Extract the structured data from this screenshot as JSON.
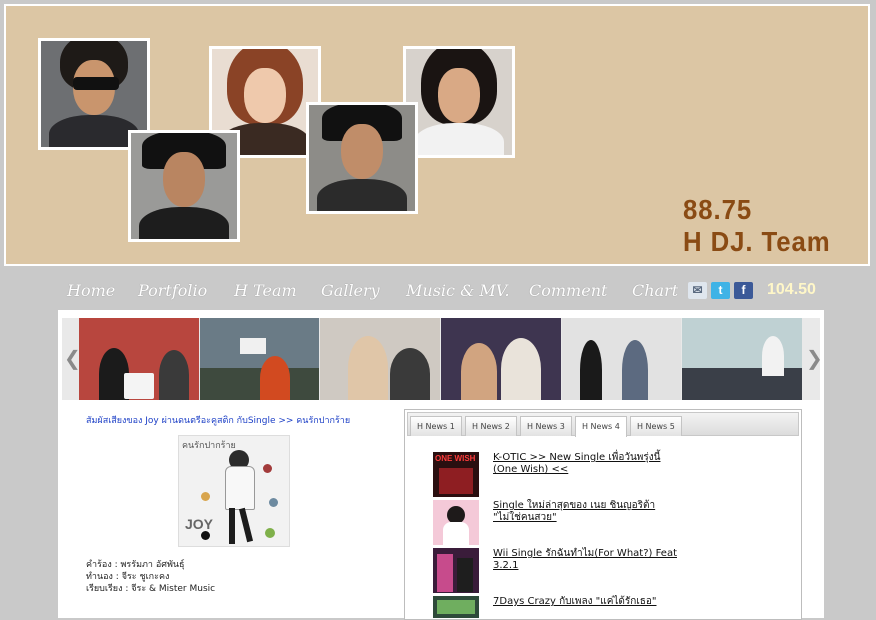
{
  "header": {
    "station_line1": "88.75",
    "station_line2": "H DJ. Team"
  },
  "nav": {
    "items": [
      "Home",
      "Portfolio",
      "H Team",
      "Gallery",
      "Music & MV.",
      "Comment",
      "Chart"
    ],
    "frequency": "104.50",
    "icons": [
      "mail-icon",
      "twitter-icon",
      "facebook-icon"
    ]
  },
  "story": {
    "title": "สัมผัสเสียงของ Joy ผ่านดนตรีอะคูสติก กับSingle >> คนรักปากร้าย",
    "cover_title": "คนรักปากร้าย",
    "cover_artist": "JOY",
    "credits": [
      "คำร้อง : พรรัมภา อัศพันธุ์",
      "ทำนอง : จีระ ชูเกะคง",
      "เรียบเรียง : จีระ & Mister Music"
    ]
  },
  "tabs": [
    "H News 1",
    "H News 2",
    "H News 3",
    "H News 4",
    "H News 5"
  ],
  "active_tab": "H News 4",
  "news": [
    {
      "title": "K-OTIC >> New Single เพื่อวันพรุ่งนี้ (One Wish) <<",
      "thumb_label": "ONE WISH"
    },
    {
      "title": "Single ใหม่ล่าสุดของ เนย ชินญอริต้า \"ไม่ใช่คนสวย\"",
      "thumb_label": ""
    },
    {
      "title": "Wii Single รักฉันทำไม(For What?) Feat 3.2.1",
      "thumb_label": ""
    },
    {
      "title": "7Days Crazy กับเพลง \"แค่ได้รักเธอ\"",
      "thumb_label": ""
    }
  ],
  "colors": {
    "banner": "#dcc6a4",
    "station_text": "#8a4b14",
    "story_link": "#1c3fc6",
    "page_bg": "#c9c9c9"
  }
}
